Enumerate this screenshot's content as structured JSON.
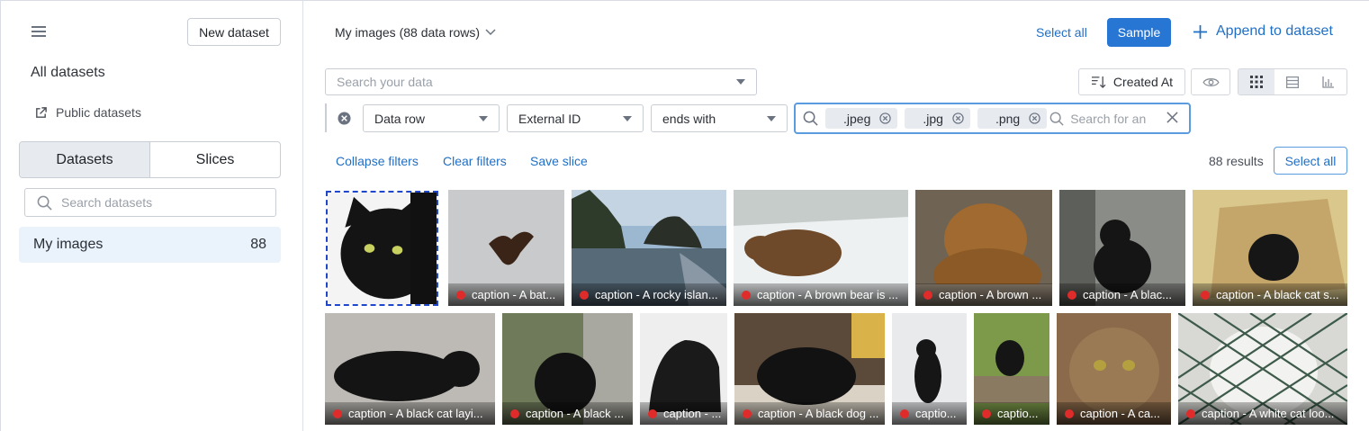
{
  "sidebar": {
    "new_dataset_label": "New dataset",
    "all_datasets_label": "All datasets",
    "public_datasets_label": "Public datasets",
    "tabs": [
      {
        "label": "Datasets",
        "active": true
      },
      {
        "label": "Slices",
        "active": false
      }
    ],
    "search_placeholder": "Search datasets",
    "datasets": [
      {
        "name": "My images",
        "count": "88"
      }
    ]
  },
  "header": {
    "dataset_selector": "My images (88 data rows)",
    "select_all_label": "Select all",
    "sample_label": "Sample",
    "append_label": "Append to dataset"
  },
  "toolbar": {
    "search_placeholder": "Search your data",
    "sort_label": "Created At",
    "view_modes": [
      "grid-icon",
      "list-icon",
      "chart-icon"
    ],
    "active_view": "grid-icon"
  },
  "filter": {
    "field_type": "Data row",
    "field": "External ID",
    "operator": "ends with",
    "values": [
      ".jpeg",
      ".jpg",
      ".png"
    ],
    "value_placeholder": "Search for an"
  },
  "actions": {
    "collapse_filters": "Collapse filters",
    "clear_filters": "Clear filters",
    "save_slice": "Save slice",
    "results": "88 results",
    "select_all_label": "Select all"
  },
  "colors": {
    "accent": "#2876d4",
    "link": "#1f6fc5",
    "status_dot": "#e02b2b",
    "focus_border": "#5b9be0"
  },
  "gallery": {
    "row1": [
      {
        "caption": "",
        "selected": true
      },
      {
        "caption": "caption - A bat..."
      },
      {
        "caption": "caption - A rocky islan..."
      },
      {
        "caption": "caption - A brown bear is ..."
      },
      {
        "caption": "caption - A brown ..."
      },
      {
        "caption": "caption - A blac..."
      },
      {
        "caption": "caption - A black cat s..."
      }
    ],
    "row2": [
      {
        "caption": "caption - A black cat layi..."
      },
      {
        "caption": "caption - A black ..."
      },
      {
        "caption": "caption - ..."
      },
      {
        "caption": "caption - A black dog ..."
      },
      {
        "caption": "captio..."
      },
      {
        "caption": "captio..."
      },
      {
        "caption": "caption - A ca..."
      },
      {
        "caption": "caption - A white cat loo..."
      }
    ]
  }
}
